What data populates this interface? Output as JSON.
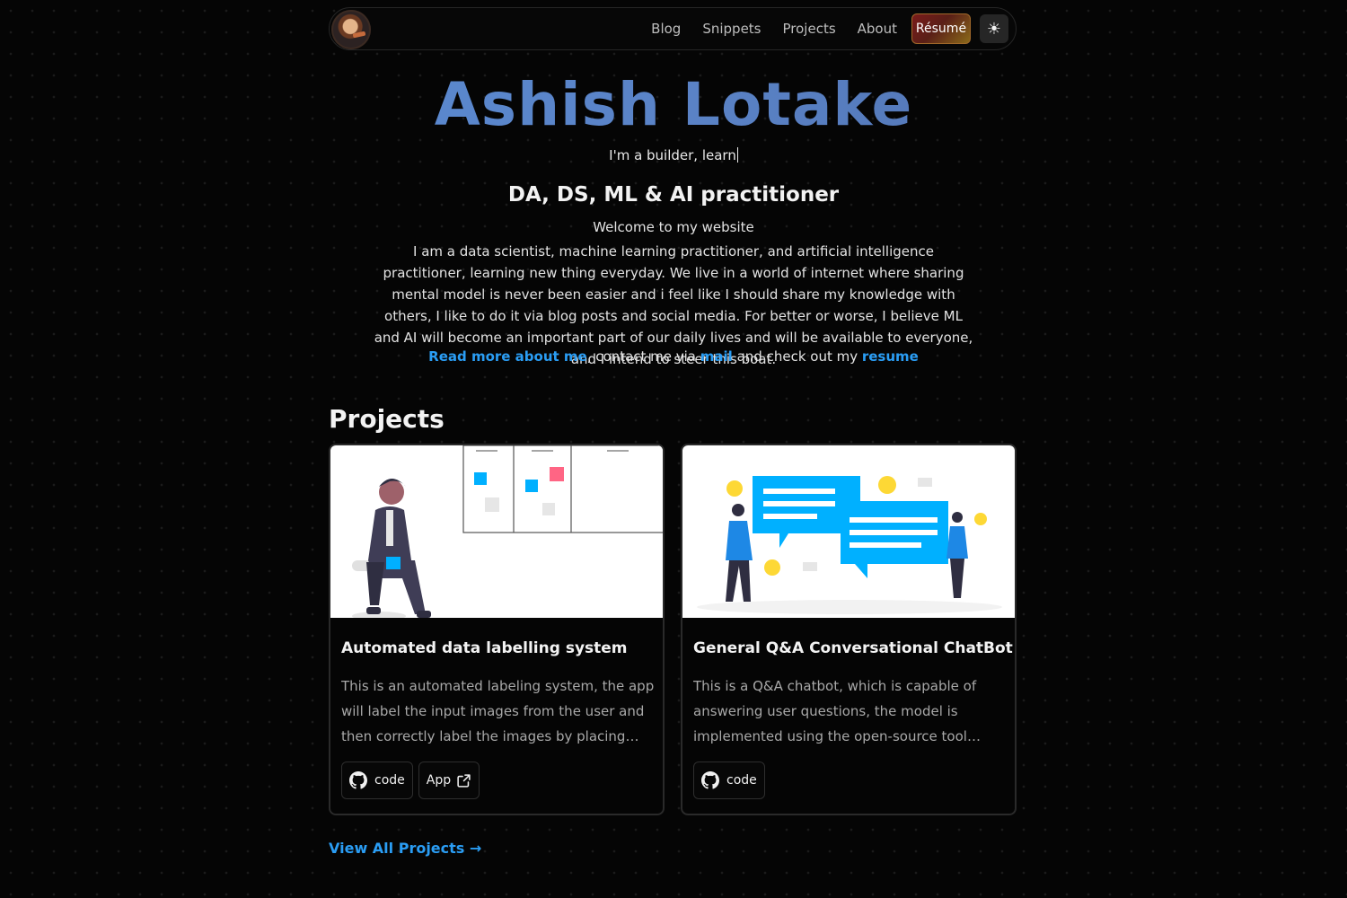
{
  "nav": {
    "links": [
      "Blog",
      "Snippets",
      "Projects",
      "About"
    ],
    "resume_label": "Résumé"
  },
  "hero": {
    "name": "Ashish Lotake",
    "typed_text": "I'm a builder, learn",
    "subtitle": "DA, DS, ML & AI practitioner",
    "welcome": "Welcome to my website",
    "bio": "I am a data scientist, machine learning practitioner, and artificial intelligence practitioner, learning new thing everyday. We live in a world of internet where sharing mental model is never been easier and i feel like I should share my knowledge with others, I like to do it via blog posts and social media. For better or worse, I believe ML and AI will become an important part of our daily lives and will be available to everyone, and I intend to steer this boat.",
    "cta": {
      "about_link": "Read more about me",
      "text1": ", contact me via ",
      "mail_link": "mail",
      "text2": " and check out my ",
      "resume_link": "resume"
    }
  },
  "projects": {
    "heading": "Projects",
    "items": [
      {
        "title": "Automated data labelling system",
        "description": "This is an automated labeling system, the app will label the input images from the user and then correctly label the images by placing them into folders according to their class.",
        "buttons": [
          "code",
          "App"
        ]
      },
      {
        "title": "General Q&A Conversational ChatBot",
        "description": "This is a Q&A chatbot, which is capable of answering user questions, the model is implemented using the open-source tool RASA. It can answer general questions.",
        "buttons": [
          "code"
        ]
      }
    ],
    "view_all": "View All Projects →"
  },
  "icons": {
    "theme_toggle": "sun-icon",
    "github": "github-icon",
    "external_link": "external-link-icon"
  },
  "colors": {
    "background": "#050505",
    "link": "#2a9df4",
    "name_gradient_start": "#5b8fd8",
    "name_gradient_end": "#4d6ba6"
  }
}
